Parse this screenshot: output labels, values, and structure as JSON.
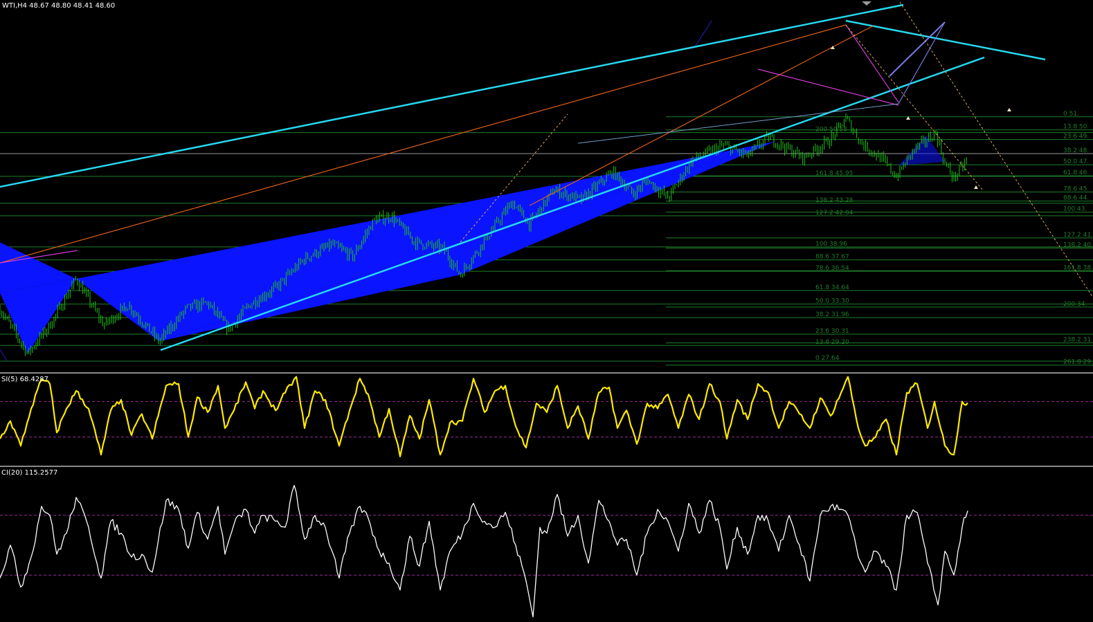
{
  "header": {
    "main": "WTI,H4  48.67 48.80 48.41 48.60",
    "rsi": "SI(5) 68.4287",
    "cci": "CI(20) 115.2577"
  },
  "colors": {
    "background": "#000000",
    "candle": "#22c01c",
    "pattern_fill": "#0a14ff",
    "channel": "#26d8ee",
    "fib_line": "#1f7f2a",
    "rsi": "#ffea00",
    "cci": "#ffffff",
    "dotted_level": "#9a2a9a",
    "orange_line": "#e0601a",
    "magenta_line": "#d63bd6",
    "projection": "#d9a85a"
  },
  "chart_data": [
    {
      "type": "line",
      "title": "",
      "series_kind": "candlestick",
      "ylim": [
        26.5,
        52.5
      ],
      "fib_levels_left": [
        {
          "label": "0 27.64",
          "value": 27.64
        },
        {
          "label": "13.8 29.20",
          "value": 29.2
        },
        {
          "label": "23.6 30.31",
          "value": 30.31
        },
        {
          "label": "38.2 31.96",
          "value": 31.96
        },
        {
          "label": "50.0 33.30",
          "value": 33.3
        },
        {
          "label": "61.8 34.64",
          "value": 34.64
        },
        {
          "label": "78.6 36.54",
          "value": 36.54
        },
        {
          "label": "88.6 37.67",
          "value": 37.67
        },
        {
          "label": "100 38.96",
          "value": 38.96
        },
        {
          "label": "127.2 42.04",
          "value": 42.04
        },
        {
          "label": "138.2 43.28",
          "value": 43.28
        },
        {
          "label": "161.8 45.95",
          "value": 45.95
        },
        {
          "label": "200 50.28",
          "value": 50.28
        }
      ],
      "fib_levels_right": [
        {
          "label": "0 51.",
          "value": 51.85
        },
        {
          "label": "13.8 50.",
          "value": 50.55
        },
        {
          "label": "23.6 49.",
          "value": 49.6
        },
        {
          "label": "38.2 48.",
          "value": 48.2
        },
        {
          "label": "50.0 47.",
          "value": 47.1
        },
        {
          "label": "61.8 46.",
          "value": 46.0
        },
        {
          "label": "78.6 45.",
          "value": 44.4
        },
        {
          "label": "88.6 44.",
          "value": 43.5
        },
        {
          "label": "100 43.",
          "value": 42.4
        },
        {
          "label": "127.2 41.",
          "value": 39.85
        },
        {
          "label": "138.2 40.",
          "value": 38.85
        },
        {
          "label": "161.8 38.",
          "value": 36.6
        },
        {
          "label": "200 34.",
          "value": 33.0
        },
        {
          "label": "238.2 31.",
          "value": 29.45
        },
        {
          "label": "261.8 29.",
          "value": 27.25
        }
      ],
      "price_path": [
        [
          0,
          32.8
        ],
        [
          40,
          28.4
        ],
        [
          75,
          31.5
        ],
        [
          110,
          35.8
        ],
        [
          150,
          31.2
        ],
        [
          185,
          33.2
        ],
        [
          230,
          29.6
        ],
        [
          270,
          32.9
        ],
        [
          300,
          33.4
        ],
        [
          330,
          30.8
        ],
        [
          360,
          33.2
        ],
        [
          400,
          35.0
        ],
        [
          440,
          37.8
        ],
        [
          480,
          39.2
        ],
        [
          510,
          38.0
        ],
        [
          540,
          41.6
        ],
        [
          565,
          42.0
        ],
        [
          600,
          39.4
        ],
        [
          640,
          38.8
        ],
        [
          665,
          36.2
        ],
        [
          700,
          39.6
        ],
        [
          740,
          43.4
        ],
        [
          765,
          41.2
        ],
        [
          800,
          44.6
        ],
        [
          840,
          43.6
        ],
        [
          885,
          46.4
        ],
        [
          915,
          44.2
        ],
        [
          935,
          45.6
        ],
        [
          965,
          43.8
        ],
        [
          1000,
          47.6
        ],
        [
          1045,
          49.0
        ],
        [
          1080,
          48.0
        ],
        [
          1110,
          49.8
        ],
        [
          1160,
          47.8
        ],
        [
          1200,
          49.6
        ],
        [
          1222,
          51.7
        ],
        [
          1245,
          49.2
        ],
        [
          1275,
          47.6
        ],
        [
          1295,
          45.9
        ],
        [
          1320,
          48.6
        ],
        [
          1340,
          49.6
        ],
        [
          1352,
          50.2
        ],
        [
          1365,
          47.2
        ],
        [
          1378,
          45.8
        ],
        [
          1398,
          47.6
        ]
      ]
    },
    {
      "type": "line",
      "title": "",
      "series_kind": "oscillator",
      "last_value": 68.4287,
      "ylim": [
        0,
        100
      ],
      "levels": [
        70,
        30
      ],
      "path": [
        [
          0,
          28
        ],
        [
          15,
          48
        ],
        [
          30,
          20
        ],
        [
          45,
          62
        ],
        [
          60,
          95
        ],
        [
          72,
          90
        ],
        [
          82,
          35
        ],
        [
          96,
          62
        ],
        [
          110,
          82
        ],
        [
          128,
          62
        ],
        [
          146,
          10
        ],
        [
          160,
          60
        ],
        [
          175,
          72
        ],
        [
          190,
          32
        ],
        [
          205,
          56
        ],
        [
          220,
          28
        ],
        [
          240,
          88
        ],
        [
          258,
          90
        ],
        [
          272,
          30
        ],
        [
          285,
          75
        ],
        [
          300,
          58
        ],
        [
          315,
          88
        ],
        [
          325,
          40
        ],
        [
          338,
          60
        ],
        [
          355,
          92
        ],
        [
          368,
          62
        ],
        [
          380,
          82
        ],
        [
          398,
          60
        ],
        [
          412,
          80
        ],
        [
          428,
          98
        ],
        [
          440,
          40
        ],
        [
          455,
          82
        ],
        [
          470,
          72
        ],
        [
          490,
          20
        ],
        [
          505,
          60
        ],
        [
          520,
          96
        ],
        [
          532,
          78
        ],
        [
          548,
          30
        ],
        [
          562,
          62
        ],
        [
          578,
          8
        ],
        [
          592,
          54
        ],
        [
          606,
          28
        ],
        [
          620,
          72
        ],
        [
          636,
          10
        ],
        [
          650,
          46
        ],
        [
          668,
          48
        ],
        [
          684,
          96
        ],
        [
          700,
          58
        ],
        [
          715,
          82
        ],
        [
          730,
          88
        ],
        [
          745,
          42
        ],
        [
          760,
          18
        ],
        [
          775,
          68
        ],
        [
          790,
          58
        ],
        [
          805,
          88
        ],
        [
          820,
          40
        ],
        [
          835,
          65
        ],
        [
          850,
          28
        ],
        [
          865,
          80
        ],
        [
          880,
          86
        ],
        [
          892,
          40
        ],
        [
          905,
          60
        ],
        [
          920,
          22
        ],
        [
          935,
          68
        ],
        [
          950,
          62
        ],
        [
          965,
          78
        ],
        [
          980,
          40
        ],
        [
          995,
          78
        ],
        [
          1010,
          50
        ],
        [
          1025,
          90
        ],
        [
          1040,
          70
        ],
        [
          1050,
          28
        ],
        [
          1065,
          72
        ],
        [
          1080,
          50
        ],
        [
          1095,
          90
        ],
        [
          1110,
          80
        ],
        [
          1125,
          40
        ],
        [
          1140,
          70
        ],
        [
          1155,
          56
        ],
        [
          1170,
          40
        ],
        [
          1185,
          74
        ],
        [
          1200,
          54
        ],
        [
          1215,
          80
        ],
        [
          1225,
          98
        ],
        [
          1240,
          40
        ],
        [
          1250,
          20
        ],
        [
          1265,
          30
        ],
        [
          1280,
          50
        ],
        [
          1295,
          10
        ],
        [
          1310,
          80
        ],
        [
          1325,
          90
        ],
        [
          1340,
          40
        ],
        [
          1350,
          70
        ],
        [
          1365,
          20
        ],
        [
          1378,
          10
        ],
        [
          1390,
          70
        ],
        [
          1398,
          68.4
        ]
      ]
    },
    {
      "type": "line",
      "title": "",
      "series_kind": "oscillator",
      "last_value": 115.2577,
      "ylim": [
        -250,
        250
      ],
      "levels": [
        100,
        -100
      ],
      "path": [
        [
          0,
          -110
        ],
        [
          15,
          0
        ],
        [
          30,
          -140
        ],
        [
          45,
          -40
        ],
        [
          60,
          130
        ],
        [
          72,
          100
        ],
        [
          82,
          -30
        ],
        [
          96,
          40
        ],
        [
          110,
          160
        ],
        [
          128,
          60
        ],
        [
          146,
          -110
        ],
        [
          160,
          80
        ],
        [
          175,
          40
        ],
        [
          190,
          -40
        ],
        [
          205,
          -30
        ],
        [
          220,
          -90
        ],
        [
          240,
          150
        ],
        [
          258,
          120
        ],
        [
          272,
          -10
        ],
        [
          285,
          110
        ],
        [
          300,
          20
        ],
        [
          315,
          130
        ],
        [
          325,
          -30
        ],
        [
          338,
          70
        ],
        [
          355,
          120
        ],
        [
          368,
          40
        ],
        [
          380,
          100
        ],
        [
          398,
          80
        ],
        [
          412,
          60
        ],
        [
          425,
          200
        ],
        [
          440,
          20
        ],
        [
          455,
          100
        ],
        [
          470,
          60
        ],
        [
          490,
          -110
        ],
        [
          505,
          40
        ],
        [
          520,
          130
        ],
        [
          532,
          90
        ],
        [
          548,
          -20
        ],
        [
          562,
          -60
        ],
        [
          578,
          -150
        ],
        [
          592,
          30
        ],
        [
          606,
          -70
        ],
        [
          620,
          80
        ],
        [
          636,
          -150
        ],
        [
          650,
          -20
        ],
        [
          668,
          40
        ],
        [
          684,
          140
        ],
        [
          700,
          80
        ],
        [
          715,
          60
        ],
        [
          730,
          110
        ],
        [
          745,
          0
        ],
        [
          760,
          -120
        ],
        [
          770,
          -240
        ],
        [
          780,
          60
        ],
        [
          790,
          40
        ],
        [
          805,
          170
        ],
        [
          820,
          30
        ],
        [
          835,
          100
        ],
        [
          850,
          -60
        ],
        [
          865,
          150
        ],
        [
          880,
          80
        ],
        [
          892,
          0
        ],
        [
          905,
          20
        ],
        [
          920,
          -100
        ],
        [
          935,
          40
        ],
        [
          950,
          120
        ],
        [
          965,
          80
        ],
        [
          980,
          -20
        ],
        [
          995,
          140
        ],
        [
          1010,
          40
        ],
        [
          1025,
          150
        ],
        [
          1040,
          60
        ],
        [
          1050,
          -80
        ],
        [
          1065,
          60
        ],
        [
          1080,
          -30
        ],
        [
          1095,
          100
        ],
        [
          1110,
          80
        ],
        [
          1125,
          -20
        ],
        [
          1140,
          100
        ],
        [
          1155,
          0
        ],
        [
          1170,
          -120
        ],
        [
          1185,
          100
        ],
        [
          1200,
          130
        ],
        [
          1215,
          120
        ],
        [
          1225,
          100
        ],
        [
          1240,
          -40
        ],
        [
          1250,
          -90
        ],
        [
          1265,
          -20
        ],
        [
          1280,
          -70
        ],
        [
          1295,
          -150
        ],
        [
          1310,
          100
        ],
        [
          1325,
          110
        ],
        [
          1340,
          -60
        ],
        [
          1355,
          -200
        ],
        [
          1365,
          -20
        ],
        [
          1378,
          -100
        ],
        [
          1390,
          60
        ],
        [
          1398,
          115.3
        ]
      ]
    }
  ]
}
